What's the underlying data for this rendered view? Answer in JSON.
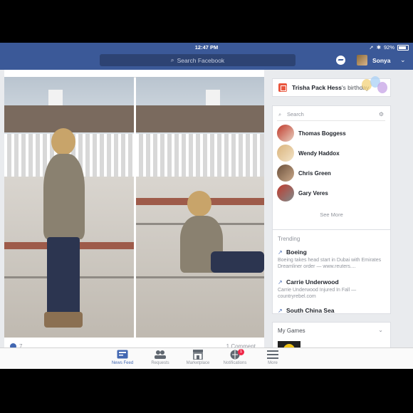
{
  "status": {
    "time": "12:47 PM",
    "battery": "92%"
  },
  "header": {
    "search_placeholder": "Search Facebook",
    "username": "Sonya"
  },
  "post": {
    "like_count": "7",
    "comment_count": "1 Comment"
  },
  "birthday": {
    "name": "Trisha Pack Hess",
    "suffix": "'s birthday"
  },
  "contacts": {
    "search_placeholder": "Search",
    "items": [
      {
        "name": "Thomas Boggess"
      },
      {
        "name": "Wendy Haddox"
      },
      {
        "name": "Chris Green"
      },
      {
        "name": "Gary Veres"
      }
    ],
    "see_more": "See More"
  },
  "trending": {
    "title": "Trending",
    "items": [
      {
        "topic": "Boeing",
        "desc": "Boeing takes head start in Dubai with Emirates Dreamliner order — www.reuters...."
      },
      {
        "topic": "Carrie Underwood",
        "desc": "Carrie Underwood Injured In Fall — countryrebel.com"
      },
      {
        "topic": "South China Sea",
        "desc": ""
      }
    ]
  },
  "games": {
    "title": "My Games"
  },
  "tabs": [
    {
      "label": "News Feed",
      "icon": "news-feed-icon"
    },
    {
      "label": "Requests",
      "icon": "requests-icon"
    },
    {
      "label": "Marketplace",
      "icon": "marketplace-icon"
    },
    {
      "label": "Notifications",
      "icon": "notifications-icon",
      "badge": "1"
    },
    {
      "label": "More",
      "icon": "menu-icon"
    }
  ],
  "colors": {
    "brand": "#3b5998",
    "accent": "#4267b2",
    "badge": "#f02849"
  }
}
